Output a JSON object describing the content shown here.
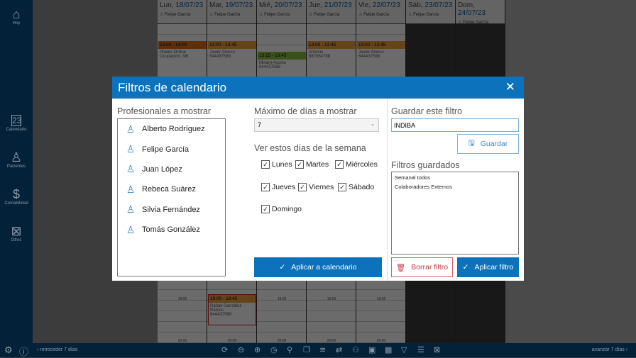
{
  "sidebar": {
    "items": [
      {
        "label": "Hoy",
        "icon": "home-icon"
      },
      {
        "label": "Calendario",
        "icon": "calendar-icon",
        "badge": "23"
      },
      {
        "label": "Pacientes",
        "icon": "person-icon"
      },
      {
        "label": "Contabilidad",
        "icon": "invoice-icon"
      },
      {
        "label": "Otros",
        "icon": "box-icon"
      }
    ]
  },
  "calendar": {
    "days": [
      {
        "name": "Lun,",
        "date": "18/07/23",
        "professional": "Felipe García"
      },
      {
        "name": "Mar,",
        "date": "19/07/23",
        "professional": "Felipe García"
      },
      {
        "name": "Mié,",
        "date": "20/07/23",
        "professional": "Felipe García"
      },
      {
        "name": "Jue,",
        "date": "21/07/23",
        "professional": "Felipe García"
      },
      {
        "name": "Vie,",
        "date": "22/07/23",
        "professional": "Felipe García"
      },
      {
        "name": "Sáb,",
        "date": "23/07/23",
        "professional": "Felipe García"
      },
      {
        "name": "Dom,",
        "date": "24/07/23",
        "professional": "Felipe García"
      }
    ],
    "events": [
      {
        "time": "13:00 - 14:00",
        "line1": "Pilates Online",
        "line2": "Ocupación: 3/6",
        "color": "#e07020"
      },
      {
        "time": "13:00 - 13:45",
        "line1": "Javier Alonso",
        "line2": "644437588",
        "color": "#f0a040"
      },
      {
        "time": "13:15 - 13:45",
        "line1": "Miriam Acosta",
        "line2": "644437588",
        "color": "#8cc040",
        "slot": "13:00"
      },
      {
        "time": "13:00 - 13:45",
        "line1": "Antonio",
        "line2": "987654798",
        "color": "#f0a040"
      },
      {
        "time": "13:00 - 13:45",
        "line1": "Javier Alonso",
        "line2": "644437588",
        "color": "#f0a040"
      },
      {
        "time": "19:00 - 19:45",
        "line1": "Rafael González Ramos",
        "line2": "644437588",
        "color": "#f0a040"
      }
    ],
    "slot_19": "19:00",
    "slot_20": "20:00"
  },
  "bottombar": {
    "prev": "‹ retroceder 7 días",
    "next": "avanzar 7 días ›"
  },
  "dialog": {
    "title": "Filtros de calendario",
    "professionals_label": "Profesionales a mostrar",
    "professionals": [
      "Alberto Rodríguez",
      "Felipe García",
      "Juan López",
      "Rebeca Suárez",
      "Silvia Fernández",
      "Tomás González"
    ],
    "max_days_label": "Máximo de días a mostrar",
    "max_days_value": "7",
    "weekdays_label": "Ver estos días de la semana",
    "weekdays": [
      {
        "label": "Lunes",
        "checked": true
      },
      {
        "label": "Martes",
        "checked": true
      },
      {
        "label": "Miércoles",
        "checked": true
      },
      {
        "label": "Jueves",
        "checked": true
      },
      {
        "label": "Viernes",
        "checked": true
      },
      {
        "label": "Sábado",
        "checked": true
      },
      {
        "label": "Domingo",
        "checked": true
      }
    ],
    "apply_calendar": "Aplicar a calendario",
    "save_label": "Guardar este filtro",
    "save_value": "INDIBA",
    "save_button": "Guardar",
    "saved_label": "Filtros guardados",
    "saved": [
      "Semanal todos",
      "Colaboradores Externos"
    ],
    "delete_button": "Borrar filtro",
    "apply_filter": "Aplicar filtro"
  }
}
